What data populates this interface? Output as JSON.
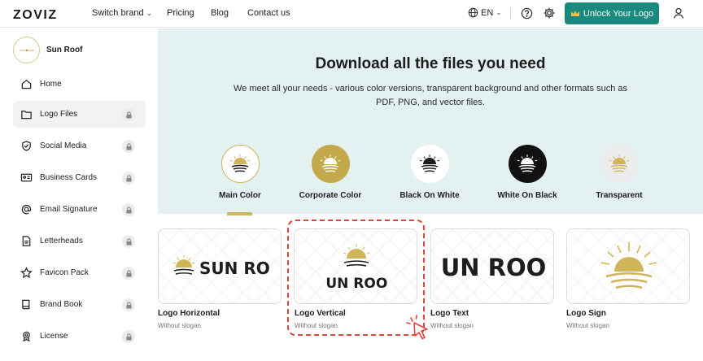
{
  "header": {
    "logo_text": "ZOVIZ",
    "nav": {
      "switch_brand": "Switch brand",
      "pricing": "Pricing",
      "blog": "Blog",
      "contact": "Contact us"
    },
    "language": "EN",
    "unlock_label": "Unlock Your Logo"
  },
  "sidebar": {
    "brand_name": "Sun Roof",
    "items": [
      {
        "label": "Home",
        "icon": "home-icon",
        "locked": false
      },
      {
        "label": "Logo Files",
        "icon": "folder-icon",
        "locked": true
      },
      {
        "label": "Social Media",
        "icon": "shield-icon",
        "locked": true
      },
      {
        "label": "Business Cards",
        "icon": "id-card-icon",
        "locked": true
      },
      {
        "label": "Email Signature",
        "icon": "at-icon",
        "locked": true
      },
      {
        "label": "Letterheads",
        "icon": "document-icon",
        "locked": true
      },
      {
        "label": "Favicon Pack",
        "icon": "star-icon",
        "locked": true
      },
      {
        "label": "Brand Book",
        "icon": "book-icon",
        "locked": true
      },
      {
        "label": "License",
        "icon": "badge-icon",
        "locked": true
      }
    ]
  },
  "hero": {
    "title": "Download all the files you need",
    "subtitle": "We meet all your needs - various color versions, transparent background and other formats such as PDF, PNG, and vector files."
  },
  "variants": [
    {
      "label": "Main Color"
    },
    {
      "label": "Corporate Color"
    },
    {
      "label": "Black On White"
    },
    {
      "label": "White On Black"
    },
    {
      "label": "Transparent"
    }
  ],
  "cards": [
    {
      "title": "Logo Horizontal",
      "subtitle": "Without slogan",
      "wordmark": "SUN ROOF"
    },
    {
      "title": "Logo Vertical",
      "subtitle": "Without slogan",
      "wordmark": "SUN ROOF"
    },
    {
      "title": "Logo Text",
      "subtitle": "Without slogan",
      "wordmark": "SUN ROOF"
    },
    {
      "title": "Logo Sign",
      "subtitle": "Without slogan"
    }
  ],
  "colors": {
    "accent": "#1a8a7e",
    "gold": "#d0b45b",
    "hero_bg": "#e3f2f1",
    "highlight": "#e0453c"
  }
}
